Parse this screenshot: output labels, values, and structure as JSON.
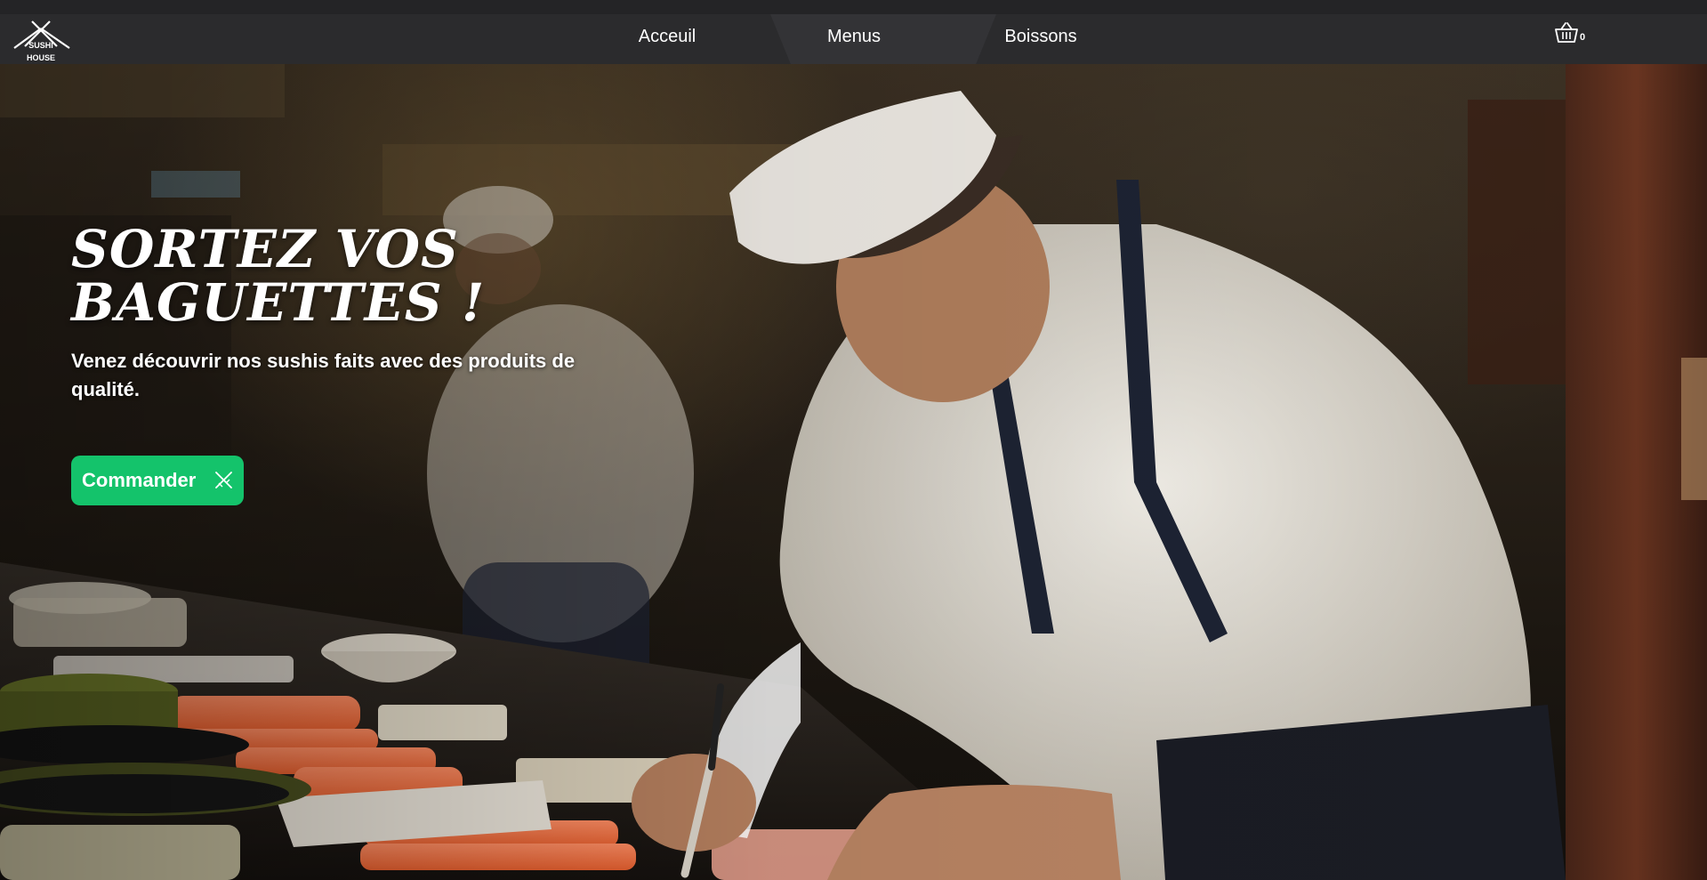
{
  "brand": {
    "logo_line1": "SUSHI",
    "logo_line2": "HOUSE"
  },
  "nav": {
    "items": [
      {
        "label": "Acceuil"
      },
      {
        "label": "Menus",
        "active": true
      },
      {
        "label": "Boissons"
      }
    ],
    "cart_count": "0",
    "cart_icon": "basket-icon"
  },
  "hero": {
    "title": "SORTEZ VOS BAGUETTES !",
    "subtitle": "Venez découvrir nos sushis faits avec des produits de qualité.",
    "cta_label": "Commander",
    "cta_icon": "chopsticks-icon"
  },
  "colors": {
    "navbar_bg": "#2b2b2d",
    "nav_active_bg": "#333336",
    "cta_bg": "#14c36b",
    "text": "#ffffff"
  }
}
